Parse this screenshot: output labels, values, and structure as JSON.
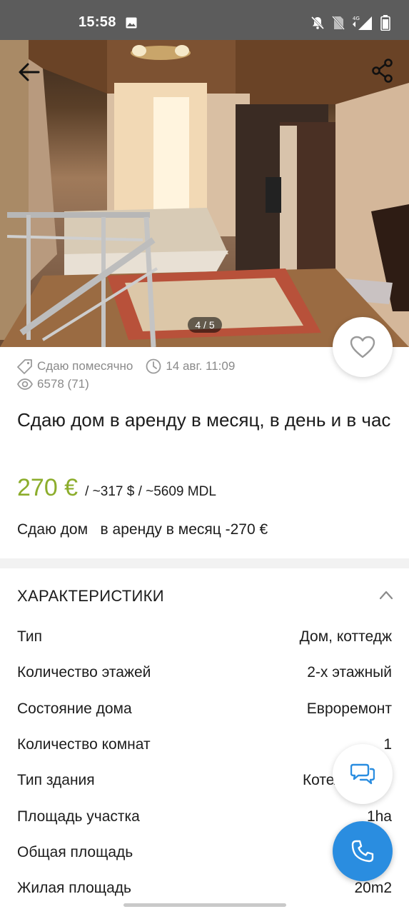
{
  "status_bar": {
    "time": "15:58",
    "icons": [
      "gallery-icon",
      "bell-off-icon",
      "sim-off-icon",
      "signal-4g-icon",
      "battery-icon"
    ]
  },
  "photo": {
    "counter": "4 / 5",
    "icons": [
      "back-arrow-icon",
      "share-icon"
    ]
  },
  "favorite": {
    "icon": "heart-outline-icon"
  },
  "meta": {
    "rent_type": "Сдаю помесячно",
    "date": "14 авг. 11:09",
    "views": "6578 (71)"
  },
  "listing": {
    "title": "Сдаю дом   в аренду в месяц,  в день и в час",
    "price": "270 €",
    "price_alt": "/ ~317 $ / ~5609 MDL",
    "description": "Сдаю дом   в аренду в месяц -270 €"
  },
  "characteristics": {
    "heading": "ХАРАКТЕРИСТИКИ",
    "rows": [
      {
        "key": "Тип",
        "value": "Дом, коттедж"
      },
      {
        "key": "Количество этажей",
        "value": "2-х этажный"
      },
      {
        "key": "Состояние дома",
        "value": "Евроремонт"
      },
      {
        "key": "Количество комнат",
        "value": "1"
      },
      {
        "key": "Тип здания",
        "value": "Котельц"
      },
      {
        "key": "Площадь участка",
        "value": "1ha"
      },
      {
        "key": "Общая площадь",
        "value": ""
      },
      {
        "key": "Жилая площадь",
        "value": "20m2"
      }
    ]
  },
  "actions": {
    "chat_icon": "chat-icon",
    "call_icon": "phone-icon",
    "call_color": "#2a8de0",
    "price_color": "#8cad2c"
  }
}
